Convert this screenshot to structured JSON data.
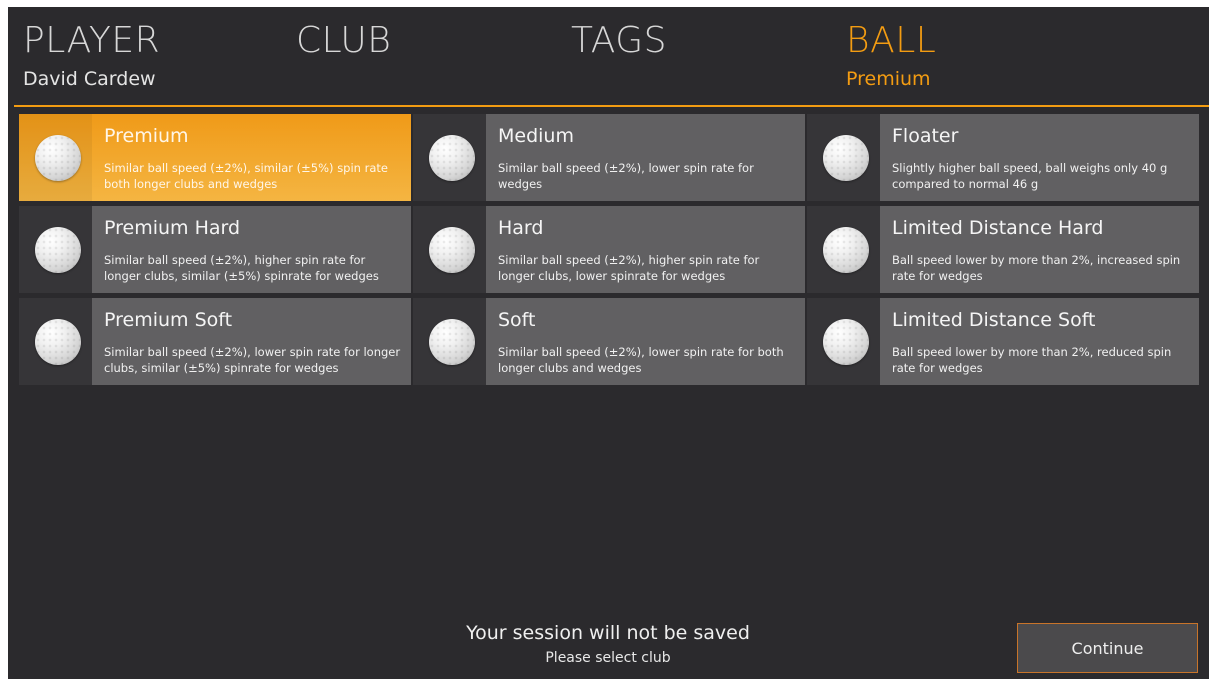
{
  "header": {
    "tabs": [
      {
        "title": "PLAYER",
        "subtitle": "David Cardew"
      },
      {
        "title": "CLUB",
        "subtitle": ""
      },
      {
        "title": "TAGS",
        "subtitle": ""
      },
      {
        "title": "BALL",
        "subtitle": "Premium"
      }
    ],
    "accent_color": "#f39c12"
  },
  "balls": [
    {
      "name": "Premium",
      "description": "Similar ball speed (±2%), similar (±5%) spin rate both longer clubs and wedges",
      "selected": true,
      "icon": "golf-ball-icon"
    },
    {
      "name": "Medium",
      "description": "Similar ball speed (±2%), lower spin rate for wedges",
      "selected": false,
      "icon": "golf-ball-icon"
    },
    {
      "name": "Floater",
      "description": "Slightly higher ball speed, ball weighs only 40 g compared to normal 46 g",
      "selected": false,
      "icon": "golf-ball-icon"
    },
    {
      "name": "Premium Hard",
      "description": "Similar ball speed (±2%), higher spin rate for longer clubs, similar (±5%) spinrate for wedges",
      "selected": false,
      "icon": "golf-ball-icon"
    },
    {
      "name": "Hard",
      "description": "Similar ball speed (±2%), higher spin rate for longer clubs, lower spinrate for wedges",
      "selected": false,
      "icon": "golf-ball-icon"
    },
    {
      "name": "Limited Distance Hard",
      "description": "Ball speed lower by more than 2%, increased spin rate for wedges",
      "selected": false,
      "icon": "golf-ball-icon"
    },
    {
      "name": "Premium Soft",
      "description": "Similar ball speed (±2%), lower spin rate for longer clubs, similar (±5%) spinrate for wedges",
      "selected": false,
      "icon": "golf-ball-icon"
    },
    {
      "name": "Soft",
      "description": "Similar ball speed (±2%), lower spin rate for both longer clubs and wedges",
      "selected": false,
      "icon": "golf-ball-icon"
    },
    {
      "name": "Limited Distance Soft",
      "description": "Ball speed lower by more than 2%, reduced spin rate for wedges",
      "selected": false,
      "icon": "golf-ball-icon"
    }
  ],
  "footer": {
    "message": "Your session will not be saved",
    "hint": "Please select club",
    "continue_label": "Continue"
  }
}
